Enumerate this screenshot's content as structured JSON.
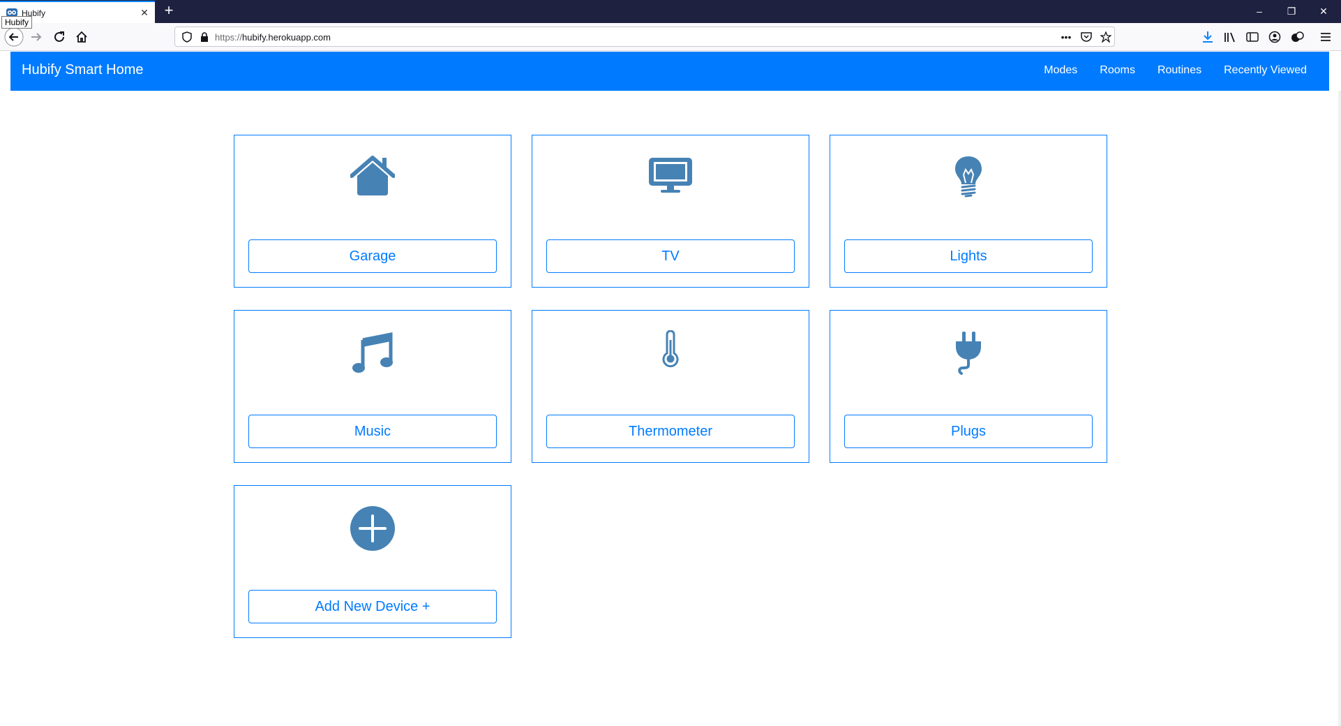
{
  "browser": {
    "tab_title": "Hubify",
    "tab_tooltip": "Hubify",
    "url_scheme": "https://",
    "url_host": "hubify.herokuapp.com"
  },
  "navbar": {
    "brand": "Hubify Smart Home",
    "links": [
      "Modes",
      "Rooms",
      "Routines",
      "Recently Viewed"
    ]
  },
  "devices": [
    {
      "label": "Garage",
      "icon": "home-icon"
    },
    {
      "label": "TV",
      "icon": "tv-icon"
    },
    {
      "label": "Lights",
      "icon": "lightbulb-icon"
    },
    {
      "label": "Music",
      "icon": "music-note-icon"
    },
    {
      "label": "Thermometer",
      "icon": "thermometer-icon"
    },
    {
      "label": "Plugs",
      "icon": "plug-icon"
    },
    {
      "label": "Add New Device +",
      "icon": "plus-circle-icon"
    }
  ],
  "colors": {
    "primary": "#007bff",
    "icon": "#4682b4",
    "chrome_dark": "#1f2140"
  }
}
